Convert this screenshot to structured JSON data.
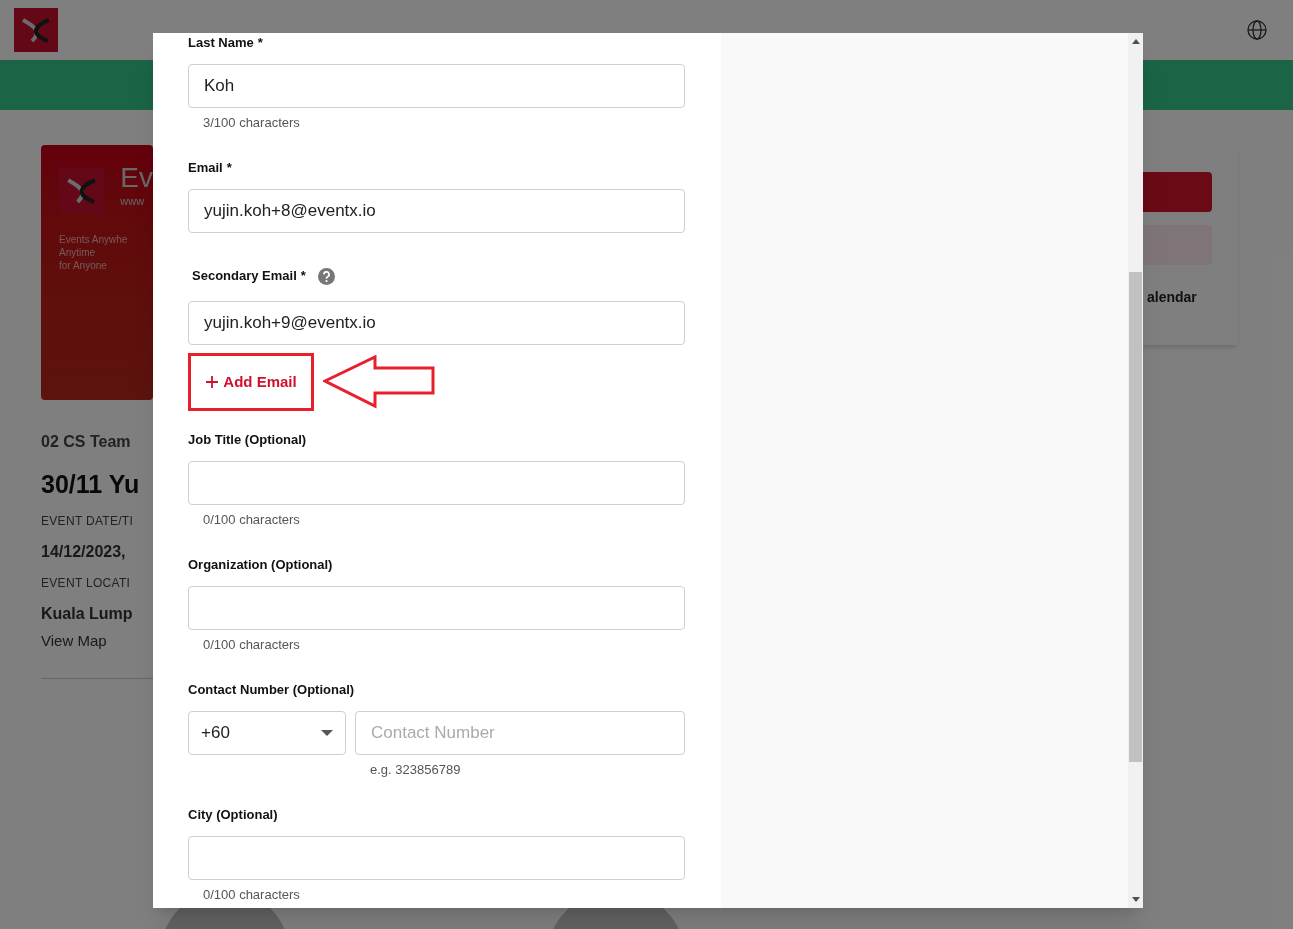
{
  "background": {
    "poster": {
      "brand": "Ev",
      "url": "www",
      "tagline": [
        "Events Anywhe",
        "Anytime",
        "for Anyone"
      ]
    },
    "event": {
      "organizer": "02 CS Team",
      "title": "30/11 Yu",
      "date_label": "EVENT DATE/TI",
      "date": "14/12/2023,",
      "location_label": "EVENT LOCATI",
      "location": "Kuala Lump",
      "map_link": "View Map"
    },
    "side_card": {
      "text": "alendar"
    }
  },
  "form_fields": [
    {
      "kind": "text",
      "label": "Last Name",
      "mark": "*",
      "value": "Koh",
      "helper": "3/100 characters"
    },
    {
      "kind": "text",
      "label": "Email",
      "mark": "*",
      "value": "yujin.koh+8@eventx.io"
    },
    {
      "kind": "text",
      "label": "Secondary Email",
      "mark": "*",
      "help": true,
      "value": "yujin.koh+9@eventx.io"
    },
    {
      "kind": "add",
      "label": "Add Email"
    },
    {
      "kind": "text",
      "label": "Job Title (Optional)",
      "helper": "0/100 characters"
    },
    {
      "kind": "text",
      "label": "Organization (Optional)",
      "helper": "0/100 characters"
    },
    {
      "kind": "phone",
      "label": "Contact Number (Optional)",
      "code": "+60",
      "placeholder": "Contact Number",
      "hint": "e.g. 323856789"
    },
    {
      "kind": "text",
      "label": "City (Optional)",
      "helper": "0/100 characters"
    }
  ]
}
